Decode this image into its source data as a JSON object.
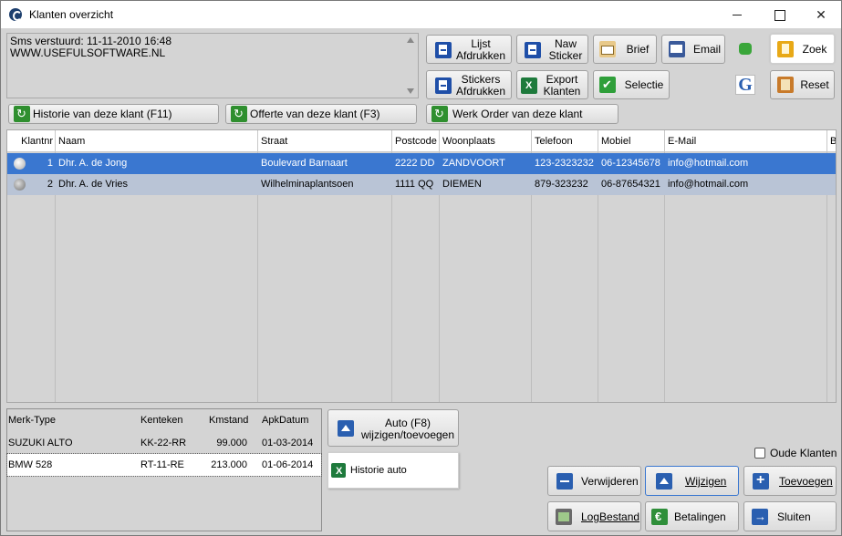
{
  "window": {
    "title": "Klanten overzicht"
  },
  "sms": {
    "text": "Sms verstuurd: 11-11-2010 16:48\nWWW.USEFULSOFTWARE.NL"
  },
  "toolbar": {
    "lijst_afdrukken": [
      "Lijst",
      "Afdrukken"
    ],
    "naw_sticker": [
      "Naw",
      "Sticker"
    ],
    "brief": "Brief",
    "email": "Email",
    "zoek": "Zoek",
    "stickers_afdrukken": [
      "Stickers",
      "Afdrukken"
    ],
    "export_klanten": [
      "Export",
      "Klanten"
    ],
    "selectie": "Selectie",
    "google": "G",
    "reset": "Reset"
  },
  "actions": {
    "historie_klant": "Historie van deze klant (F11)",
    "offerte_klant": "Offerte van deze klant (F3)",
    "werk_order": "Werk Order van deze klant"
  },
  "customers": {
    "headers": [
      "Klantnr",
      "Naam",
      "Straat",
      "Postcode",
      "Woonplaats",
      "Telefoon",
      "Mobiel",
      "E-Mail",
      "Ba"
    ],
    "rows": [
      {
        "nr": "1",
        "naam": "Dhr. A. de Jong",
        "straat": "Boulevard Barnaart",
        "postcode": "2222 DD",
        "woonplaats": "ZANDVOORT",
        "telefoon": "123-2323232",
        "mobiel": "06-12345678",
        "email": "info@hotmail.com"
      },
      {
        "nr": "2",
        "naam": "Dhr. A. de Vries",
        "straat": "Wilhelminaplantsoen",
        "postcode": "1111 QQ",
        "woonplaats": "DIEMEN",
        "telefoon": "879-323232",
        "mobiel": "06-87654321",
        "email": "info@hotmail.com"
      }
    ]
  },
  "vehicles": {
    "headers": [
      "Merk-Type",
      "Kenteken",
      "Kmstand",
      "ApkDatum"
    ],
    "rows": [
      {
        "merk": "SUZUKI ALTO",
        "kenteken": "KK-22-RR",
        "km": "99.000",
        "apk": "01-03-2014"
      },
      {
        "merk": "BMW 528",
        "kenteken": "RT-11-RE",
        "km": "213.000",
        "apk": "01-06-2014"
      }
    ]
  },
  "auto": {
    "button": [
      "Auto (F8)",
      "wijzigen/toevoegen"
    ],
    "historie_auto": "Historie auto"
  },
  "oude_klanten": "Oude Klanten",
  "bottom": {
    "verwijderen": "Verwijderen",
    "wijzigen": "Wijzigen",
    "toevoegen": "Toevoegen",
    "logbestand": "LogBestand",
    "betalingen": "Betalingen",
    "sluiten": "Sluiten"
  }
}
